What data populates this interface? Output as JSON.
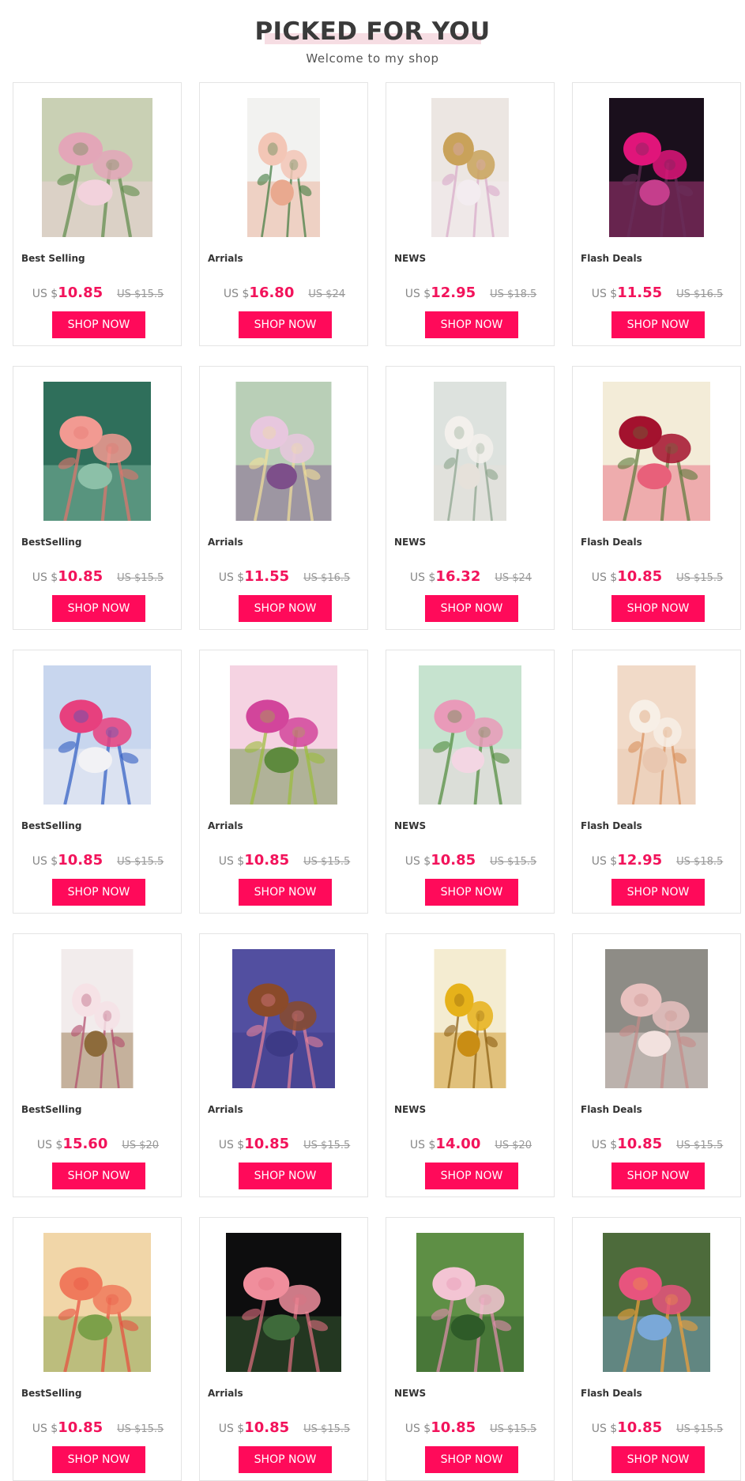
{
  "header": {
    "title": "PICKED FOR YOU",
    "subtitle": "Welcome to my shop"
  },
  "colors": {
    "accent": "#ff0a5a",
    "price": "#f2135b",
    "title_highlight": "#f6dde3"
  },
  "currency_prefix": "US $",
  "button_label": "SHOP NOW",
  "rows": [
    [
      {
        "tag": "Best Selling",
        "price": "10.85",
        "old": "US $15.5",
        "art": "pink-peony-bouquet"
      },
      {
        "tag": "Arrials",
        "price": "16.80",
        "old": "US $24",
        "art": "peach-roses-on-white"
      },
      {
        "tag": "NEWS",
        "price": "12.95",
        "old": "US $18.5",
        "art": "golden-tulips"
      },
      {
        "tag": "Flash Deals",
        "price": "11.55",
        "old": "US $16.5",
        "art": "rose-under-glass-dome"
      }
    ],
    [
      {
        "tag": "BestSelling",
        "price": "10.85",
        "old": "US $15.5",
        "art": "coral-rose-closeup"
      },
      {
        "tag": "Arrials",
        "price": "11.55",
        "old": "US $16.5",
        "art": "pastel-lilies"
      },
      {
        "tag": "NEWS",
        "price": "16.32",
        "old": "US $24",
        "art": "white-roses"
      },
      {
        "tag": "Flash Deals",
        "price": "10.85",
        "old": "US $15.5",
        "art": "red-roses"
      }
    ],
    [
      {
        "tag": "BestSelling",
        "price": "10.85",
        "old": "US $15.5",
        "art": "blue-pink-flowers-butterfly"
      },
      {
        "tag": "Arrials",
        "price": "10.85",
        "old": "US $15.5",
        "art": "orchids-with-butterflies"
      },
      {
        "tag": "NEWS",
        "price": "10.85",
        "old": "US $15.5",
        "art": "pink-roses-garden"
      },
      {
        "tag": "Flash Deals",
        "price": "12.95",
        "old": "US $18.5",
        "art": "cream-lilies"
      }
    ],
    [
      {
        "tag": "BestSelling",
        "price": "15.60",
        "old": "US $20",
        "art": "white-magnolia-pearls"
      },
      {
        "tag": "Arrials",
        "price": "10.85",
        "old": "US $15.5",
        "art": "flower-cross"
      },
      {
        "tag": "NEWS",
        "price": "14.00",
        "old": "US $20",
        "art": "golden-tree"
      },
      {
        "tag": "Flash Deals",
        "price": "10.85",
        "old": "US $15.5",
        "art": "pink-iris"
      }
    ],
    [
      {
        "tag": "BestSelling",
        "price": "10.85",
        "old": "US $15.5",
        "art": "orange-rose"
      },
      {
        "tag": "Arrials",
        "price": "10.85",
        "old": "US $15.5",
        "art": "dewy-pink-rose"
      },
      {
        "tag": "NEWS",
        "price": "10.85",
        "old": "US $15.5",
        "art": "pink-orchids"
      },
      {
        "tag": "Flash Deals",
        "price": "10.85",
        "old": "US $15.5",
        "art": "dandelion-spheres"
      }
    ]
  ]
}
